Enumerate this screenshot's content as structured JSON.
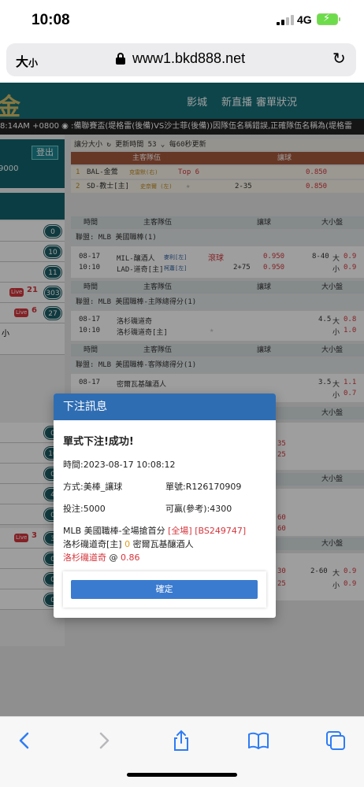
{
  "status": {
    "time": "10:08",
    "network": "4G"
  },
  "browser": {
    "text_size": "大",
    "text_size_small": "小",
    "url": "www1.bkd888.net"
  },
  "site": {
    "logo": "金",
    "nav": [
      "影城",
      "新直播",
      "審單狀況"
    ],
    "marquee": "8:14AM +0800  ◉ :備聯賽盃(堤格雷(後備)VS沙士菲(後備))因隊伍名稱錯誤,正確隊伍名稱為(堤格雷",
    "logout": "登出",
    "balance": "9000",
    "side_counts": [
      "0",
      "10",
      "11",
      "303",
      "27",
      "0",
      "10",
      "0",
      "4",
      "0",
      "3",
      "0",
      "0",
      "0"
    ],
    "live_label": "Live",
    "live_nums": [
      "21",
      "6",
      "3"
    ],
    "side_text": "小",
    "filter_bar": "讓分大小  ↻  更新時間  53  ⌄ 每60秒更新",
    "fav_header_team": "主客隊伍",
    "fav_header_hdp": "讓球",
    "fav1": {
      "n": "1",
      "team": "BAL-金鶯",
      "pitcher": "克雷默(右)",
      "tag": "Top 6",
      "odds": "0.850"
    },
    "fav2": {
      "n": "2",
      "team": "SD-教士[主]",
      "pitcher": "史奈爾 (左)",
      "line": "2-35",
      "odds": "0.850"
    },
    "col": {
      "time": "時間",
      "team": "主客隊伍",
      "hdp": "讓球",
      "ou": "大小盤"
    },
    "league1": "聯盟: MLB 美國職棒(1)",
    "g1": {
      "date": "08-17",
      "time": "10:10",
      "home": "MIL-釀酒人",
      "hp": "麥利[左]",
      "away": "LAD-道奇[主]",
      "ap": "柯蕭[左]",
      "live": "滾球",
      "line": "2+75",
      "o1": "0.950",
      "o2": "0.950",
      "ou": "8-40",
      "big": "大",
      "small": "小",
      "v1": "0.9",
      "v2": "0.9"
    },
    "league2": "聯盟: MLB 美國職棒-主隊總得分(1)",
    "g2": {
      "date": "08-17",
      "time": "10:10",
      "home": "洛杉磯道奇",
      "away": "洛杉磯道奇[主]",
      "ou": "4.5",
      "big": "大",
      "small": "小",
      "v1": "0.8",
      "v2": "1.0"
    },
    "league3": "聯盟: MLB 美國職棒-客隊總得分(1)",
    "g3": {
      "date": "08-17",
      "home": "密爾瓦基釀酒人",
      "ou": "3.5",
      "big": "大",
      "small": "小",
      "v1": "1.1",
      "v2": "0.7"
    },
    "bg_bits": [
      "35",
      "25",
      "60",
      "60",
      "30",
      "25",
      "2-60",
      "大",
      "小",
      "0.9",
      "0.9"
    ]
  },
  "modal": {
    "title": "下注訊息",
    "success": "單式下注!成功!",
    "time": "時間:2023-08-17 10:08:12",
    "method": "方式:美棒_讓球",
    "ticket": "單號:R126170909",
    "stake": "投注:5000",
    "win": "可贏(參考):4300",
    "league": "MLB 美國職棒-全場搶首分",
    "tag1": "[全場]",
    "tag2": "[BS249747]",
    "home": "洛杉磯道奇[主]",
    "zero": "0",
    "away": "密爾瓦基釀酒人",
    "pick": "洛杉磯道奇",
    "at": "@",
    "odds": "0.86",
    "confirm": "確定"
  },
  "toolbar": {
    "icons": [
      "back-icon",
      "forward-icon",
      "share-icon",
      "bookmarks-icon",
      "tabs-icon"
    ]
  }
}
